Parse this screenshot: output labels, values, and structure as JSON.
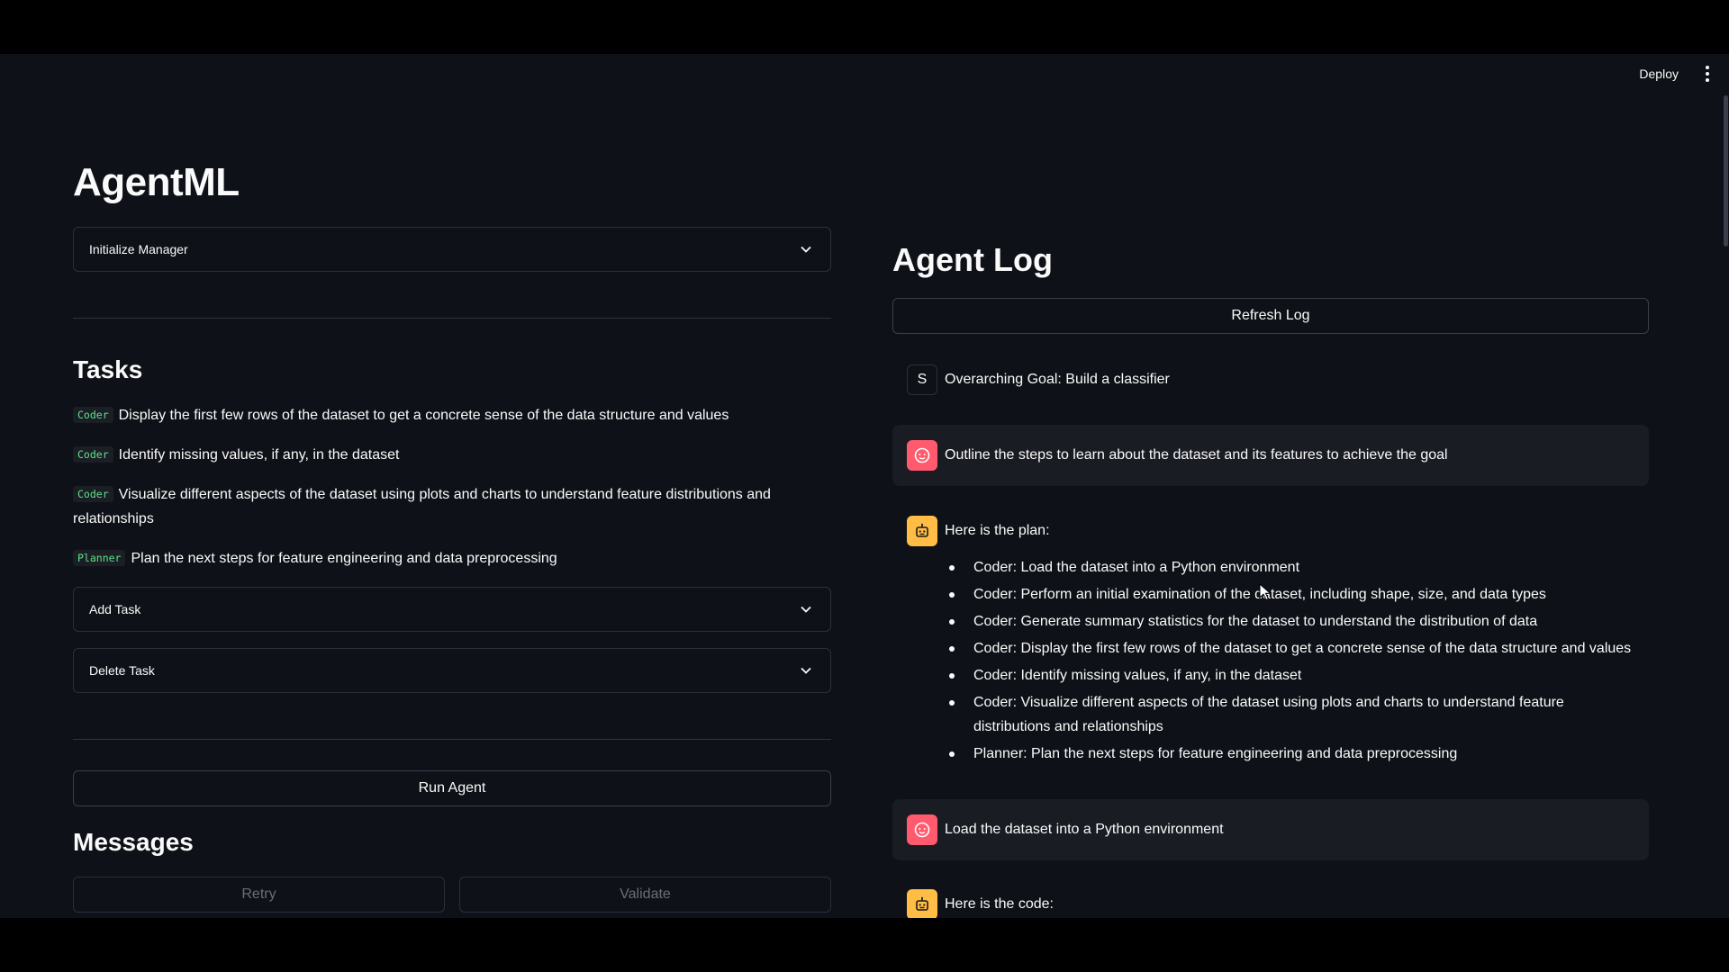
{
  "topbar": {
    "deploy_label": "Deploy",
    "menu_icon": "kebab-menu-icon"
  },
  "app": {
    "title": "AgentML"
  },
  "left": {
    "init_manager_label": "Initialize Manager",
    "tasks_heading": "Tasks",
    "tasks": [
      {
        "tag": "Coder",
        "text": "Display the first few rows of the dataset to get a concrete sense of the data structure and values"
      },
      {
        "tag": "Coder",
        "text": "Identify missing values, if any, in the dataset"
      },
      {
        "tag": "Coder",
        "text": "Visualize different aspects of the dataset using plots and charts to understand feature distributions and relationships"
      },
      {
        "tag": "Planner",
        "text": "Plan the next steps for feature engineering and data preprocessing"
      }
    ],
    "add_task_label": "Add Task",
    "delete_task_label": "Delete Task",
    "run_agent_label": "Run Agent",
    "messages_heading": "Messages",
    "retry_label": "Retry",
    "validate_label": "Validate"
  },
  "right": {
    "heading": "Agent Log",
    "refresh_label": "Refresh Log",
    "messages": [
      {
        "role": "user",
        "avatar_letter": "S",
        "text": "Overarching Goal: Build a classifier"
      },
      {
        "role": "human",
        "text": "Outline the steps to learn about the dataset and its features to achieve the goal"
      },
      {
        "role": "bot",
        "text": "Here is the plan:"
      },
      {
        "role": "human",
        "text": "Load the dataset into a Python environment"
      },
      {
        "role": "bot",
        "text": "Here is the code:"
      }
    ],
    "plan_items": [
      "Coder: Load the dataset into a Python environment",
      "Coder: Perform an initial examination of the dataset, including shape, size, and data types",
      "Coder: Generate summary statistics for the dataset to understand the distribution of data",
      "Coder: Display the first few rows of the dataset to get a concrete sense of the data structure and values",
      "Coder: Identify missing values, if any, in the dataset",
      "Coder: Visualize different aspects of the dataset using plots and charts to understand feature distributions and relationships",
      "Planner: Plan the next steps for feature engineering and data preprocessing"
    ]
  },
  "colors": {
    "background": "#0e1117",
    "human_avatar": "#ff5a6e",
    "bot_avatar": "#ffbd45",
    "tag_text": "#5ce488"
  }
}
